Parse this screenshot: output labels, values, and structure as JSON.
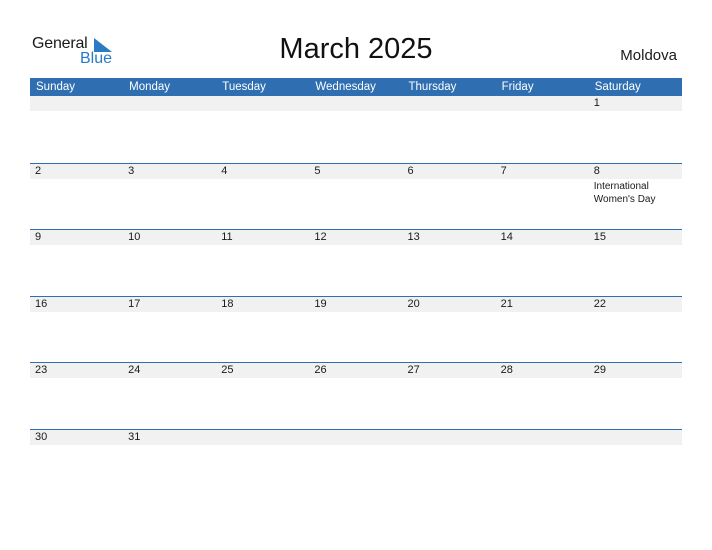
{
  "logo": {
    "word1": "General",
    "word2": "Blue"
  },
  "title": "March 2025",
  "country": "Moldova",
  "weekdays": [
    "Sunday",
    "Monday",
    "Tuesday",
    "Wednesday",
    "Thursday",
    "Friday",
    "Saturday"
  ],
  "weeks": [
    [
      {
        "d": ""
      },
      {
        "d": ""
      },
      {
        "d": ""
      },
      {
        "d": ""
      },
      {
        "d": ""
      },
      {
        "d": ""
      },
      {
        "d": "1"
      }
    ],
    [
      {
        "d": "2"
      },
      {
        "d": "3"
      },
      {
        "d": "4"
      },
      {
        "d": "5"
      },
      {
        "d": "6"
      },
      {
        "d": "7"
      },
      {
        "d": "8",
        "event": "International Women's Day"
      }
    ],
    [
      {
        "d": "9"
      },
      {
        "d": "10"
      },
      {
        "d": "11"
      },
      {
        "d": "12"
      },
      {
        "d": "13"
      },
      {
        "d": "14"
      },
      {
        "d": "15"
      }
    ],
    [
      {
        "d": "16"
      },
      {
        "d": "17"
      },
      {
        "d": "18"
      },
      {
        "d": "19"
      },
      {
        "d": "20"
      },
      {
        "d": "21"
      },
      {
        "d": "22"
      }
    ],
    [
      {
        "d": "23"
      },
      {
        "d": "24"
      },
      {
        "d": "25"
      },
      {
        "d": "26"
      },
      {
        "d": "27"
      },
      {
        "d": "28"
      },
      {
        "d": "29"
      }
    ],
    [
      {
        "d": "30"
      },
      {
        "d": "31"
      },
      {
        "d": ""
      },
      {
        "d": ""
      },
      {
        "d": ""
      },
      {
        "d": ""
      },
      {
        "d": ""
      }
    ]
  ],
  "colors": {
    "header": "#2f6fb1",
    "logo_blue": "#2a7bc4",
    "date_strip": "#f1f1f1"
  }
}
